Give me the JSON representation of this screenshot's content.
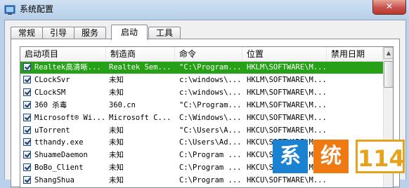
{
  "window": {
    "title": "系统配置",
    "close_label": "✕"
  },
  "tabs": [
    {
      "label": "常规",
      "active": false
    },
    {
      "label": "引导",
      "active": false
    },
    {
      "label": "服务",
      "active": false
    },
    {
      "label": "启动",
      "active": true
    },
    {
      "label": "工具",
      "active": false
    }
  ],
  "columns": [
    "启动项目",
    "制造商",
    "命令",
    "位置",
    "禁用日期"
  ],
  "rows": [
    {
      "item": "Realtek高清晰...",
      "maker": "Realtek Sem...",
      "command": "\"C:\\Program...",
      "location": "HKLM\\SOFTWARE\\M...",
      "checked": true,
      "selected": true
    },
    {
      "item": "CLockSvr",
      "maker": "未知",
      "command": "c:\\windows\\...",
      "location": "HKLM\\SOFTWARE\\M...",
      "checked": true
    },
    {
      "item": "CLockSM",
      "maker": "未知",
      "command": "c:\\windows\\...",
      "location": "HKLM\\SOFTWARE\\M...",
      "checked": true
    },
    {
      "item": "360 杀毒",
      "maker": "360.cn",
      "command": "\"C:\\Program...",
      "location": "HKLM\\SOFTWARE\\M...",
      "checked": true
    },
    {
      "item": "Microsoft® Wi...",
      "maker": "Microsoft C...",
      "command": "C:\\Windows\\...",
      "location": "HKCU\\SOFTWARE\\M...",
      "checked": true
    },
    {
      "item": "uTorrent",
      "maker": "未知",
      "command": "\"C:\\Users\\A...",
      "location": "HKCU\\SOFTWARE\\M...",
      "checked": true
    },
    {
      "item": "tthandy.exe",
      "maker": "未知",
      "command": "C:\\Users\\Ad...",
      "location": "HKCU\\SOFTWARE\\M...",
      "checked": true
    },
    {
      "item": "ShuameDaemon",
      "maker": "未知",
      "command": "C:\\Program ...",
      "location": "HKCU\\SOFTWARE\\M...",
      "checked": true
    },
    {
      "item": "BoBo_Client",
      "maker": "未知",
      "command": "C:\\Program ...",
      "location": "HKCU\\SOFTWARE\\M...",
      "checked": true
    },
    {
      "item": "ShangShua",
      "maker": "未知",
      "command": "C:\\Program ...",
      "location": "HKCU\\SOFTWARE\\M...",
      "checked": true
    }
  ],
  "watermark": {
    "char1": "系",
    "char2": "统",
    "num": "114"
  },
  "colors": {
    "selected_row": "#26a017",
    "title_bar": "#b9d1ea"
  }
}
